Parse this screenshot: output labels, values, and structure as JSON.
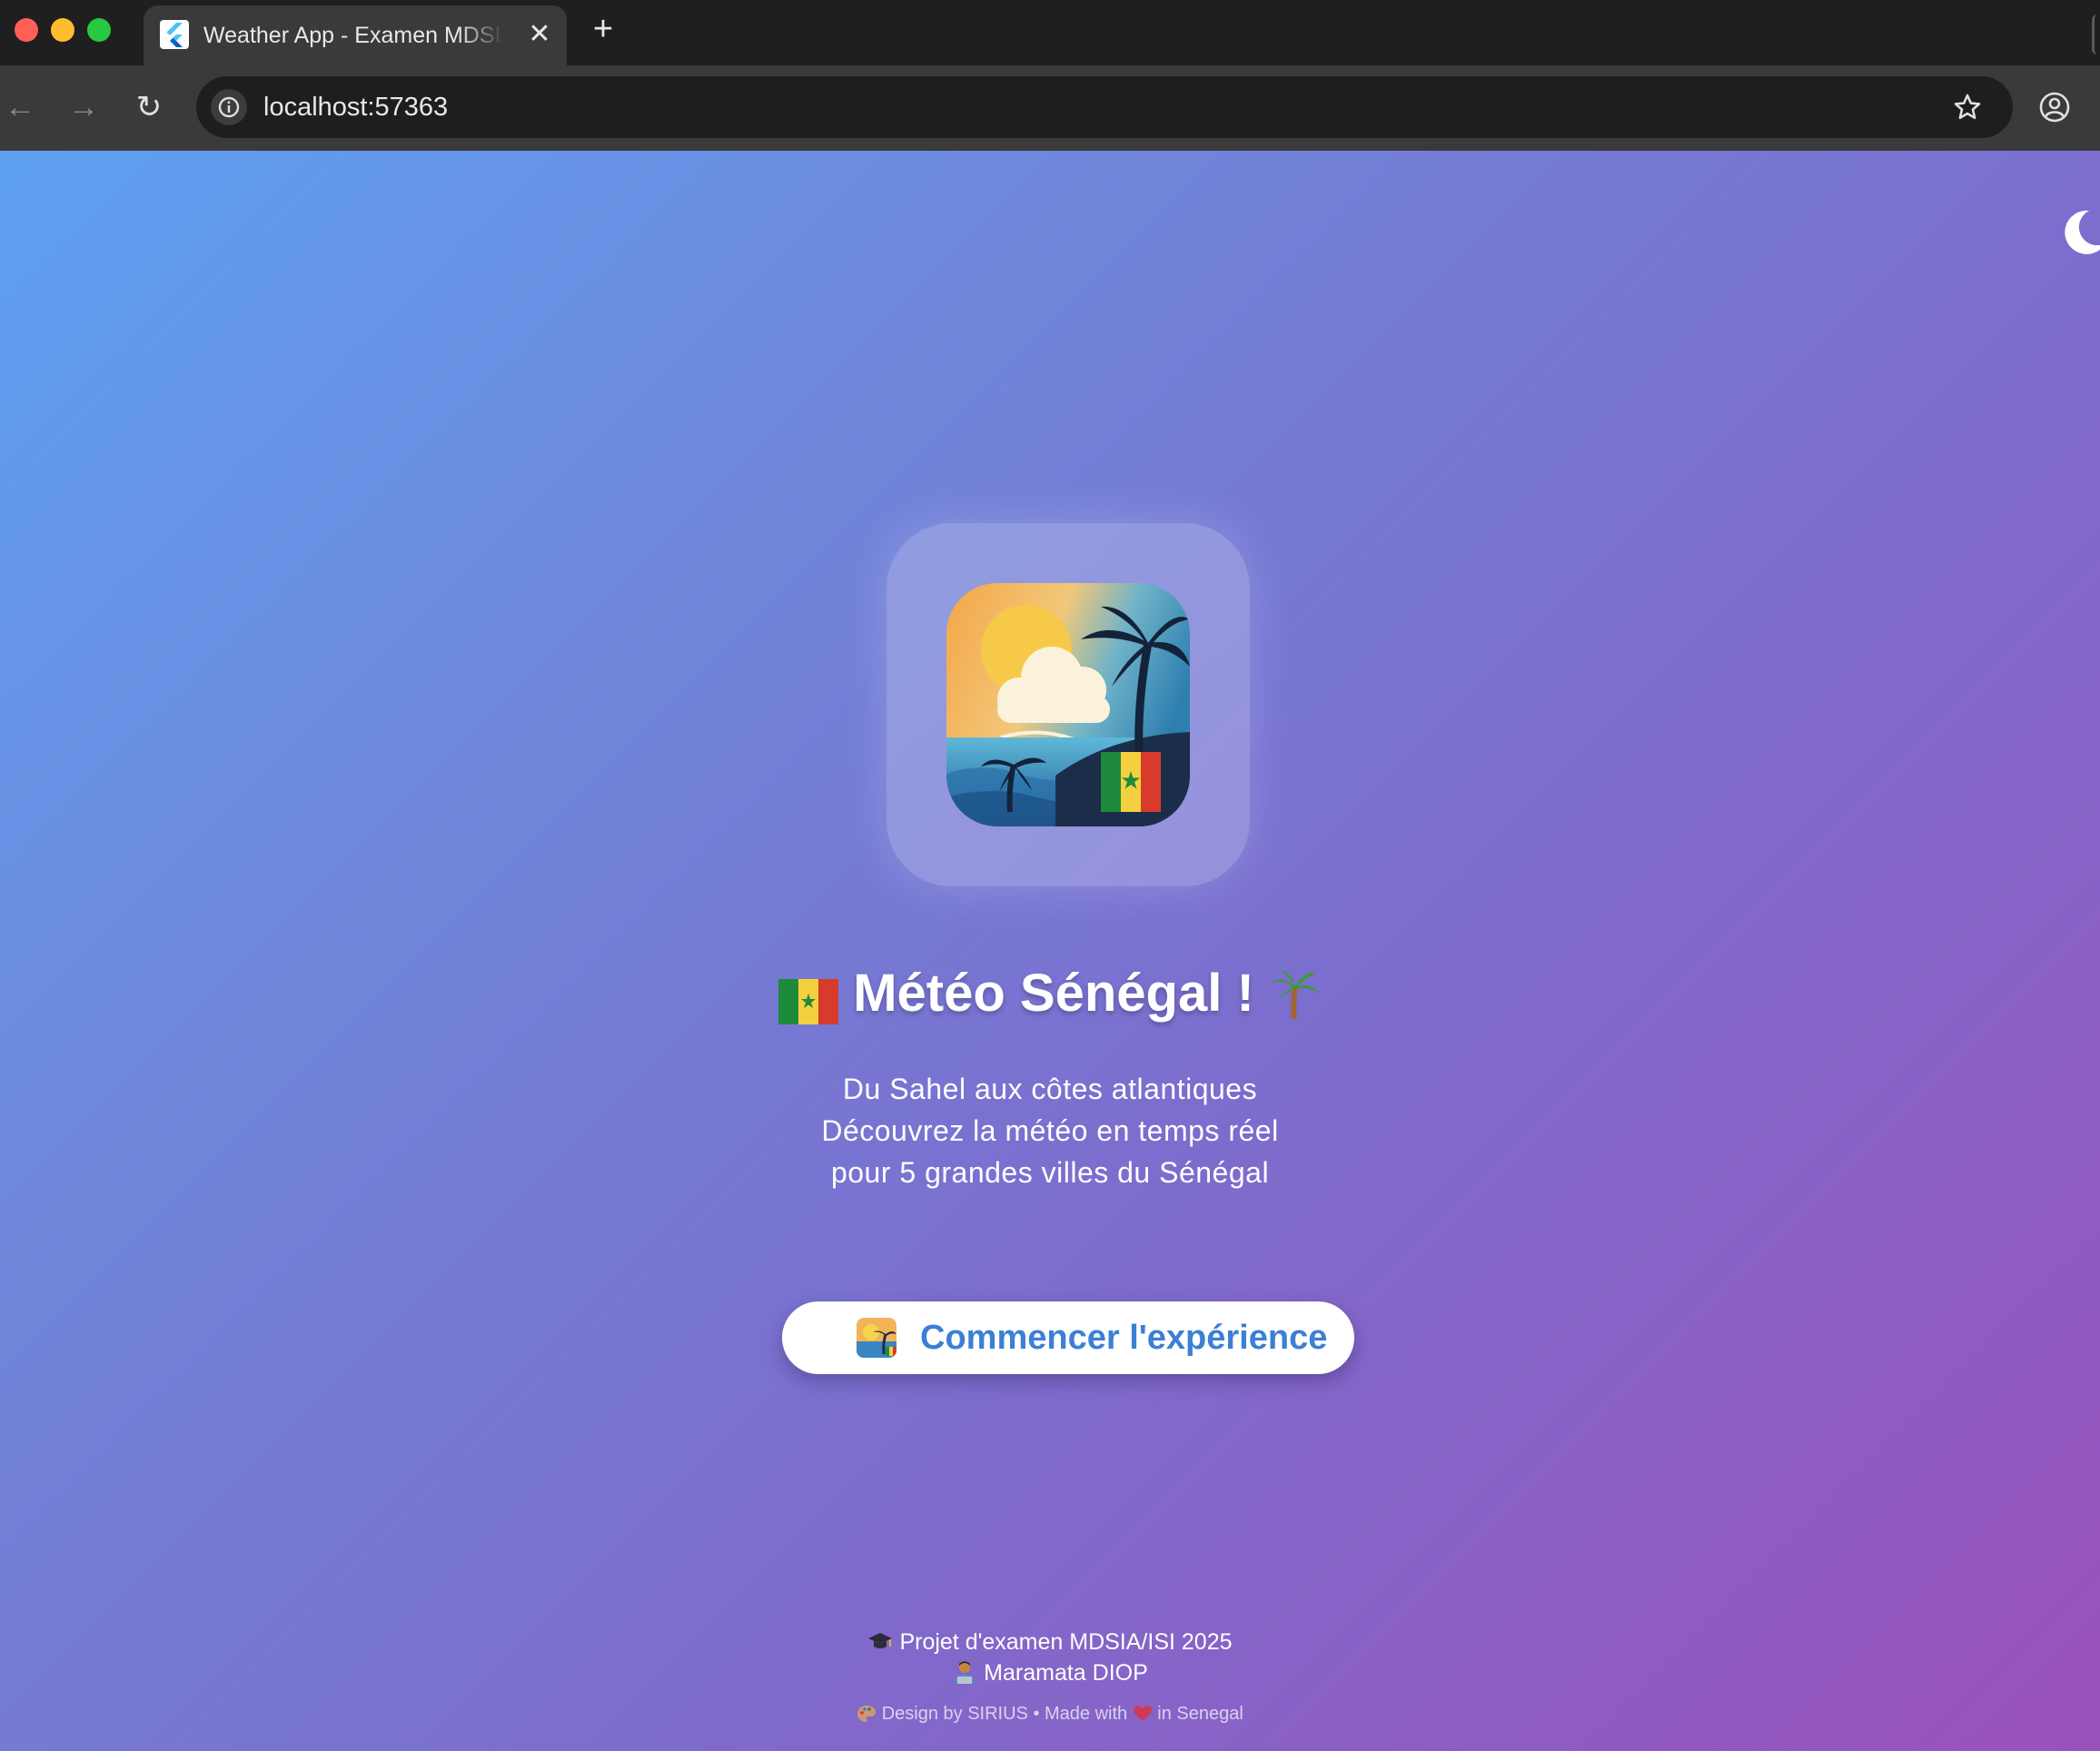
{
  "browser": {
    "tab_title": "Weather App - Examen MDSIA/ISI",
    "close_glyph": "✕",
    "new_tab_glyph": "+",
    "back_glyph": "←",
    "forward_glyph": "→",
    "reload_glyph": "↻",
    "url": "localhost:57363",
    "icons": [
      "flutter-favicon",
      "info-icon",
      "star-icon",
      "profile-icon"
    ]
  },
  "page": {
    "theme_toggle_icon": "crescent-moon-icon",
    "logo_icon": "senegal-weather-app-icon",
    "title": "Météo Sénégal !",
    "subtitle_lines": [
      "Du Sahel aux côtes atlantiques",
      "Découvrez la météo en temps réel",
      "pour 5 grandes villes du Sénégal"
    ],
    "cta_label": "Commencer l'expérience",
    "footer": {
      "project": "Projet d'examen MDSIA/ISI 2025",
      "author": "Maramata DIOP",
      "credits_prefix": "Design by SIRIUS • Made with",
      "credits_suffix": "in Senegal"
    },
    "colors": {
      "gradient_start": "#5ea1f2",
      "gradient_end": "#9a52bb",
      "cta_text": "#3b7fd6",
      "senegal_green": "#1e8a3c",
      "senegal_yellow": "#f4d03f",
      "senegal_red": "#d83a2b"
    }
  }
}
